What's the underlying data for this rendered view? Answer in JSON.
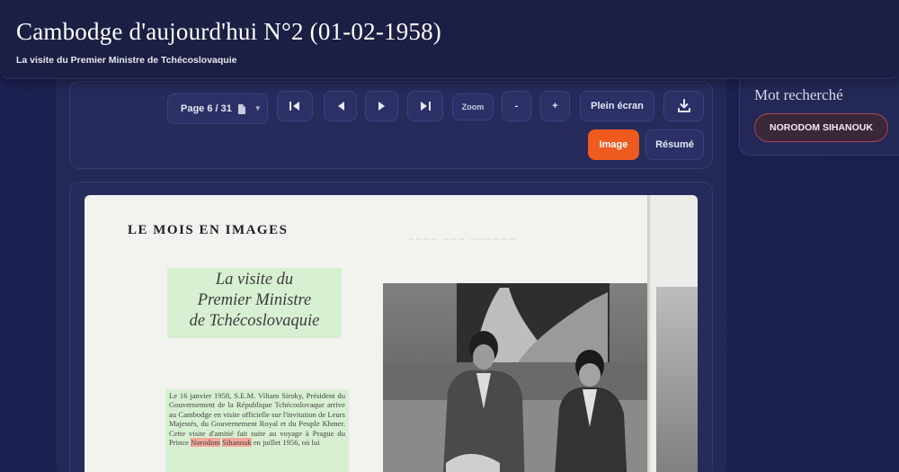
{
  "header": {
    "title": "Cambodge d'aujourd'hui N°2 (01-02-1958)",
    "subtitle": "La visite du Premier Ministre de Tchécoslovaquie"
  },
  "toolbar": {
    "page_label": "Page 6 / 31",
    "zoom_label": "Zoom",
    "zoom_out": "-",
    "zoom_in": "+",
    "fullscreen": "Plein écran",
    "view_image": "Image",
    "view_summary": "Résumé"
  },
  "document": {
    "section_heading": "LE MOIS EN IMAGES",
    "article_title_lines": [
      "La visite du",
      "Premier Ministre",
      "de Tchécoslovaquie"
    ],
    "body_text_before": "Le 16 janvier 1958, S.E.M. Viliam Siroky, Président du Gouvernement de la République Tchécoslovaque arrive au Cambodge en visite officielle sur l'invitation de Leurs Majestés, du Gouvernement Royal et du Peuple Khmer. Cette visite d'amitié fait suite au voyage à Prague du Prince",
    "body_highlight_1": "Norodom",
    "body_highlight_2": "Sihanouk",
    "body_text_after": "en juillet 1956, où lui"
  },
  "sidebar": {
    "heading": "Mot recherché",
    "keyword": "NORODOM SIHANOUK"
  },
  "colors": {
    "background": "#1c2050",
    "accent": "#ef5a1e",
    "keyword_border": "#a8475a"
  }
}
